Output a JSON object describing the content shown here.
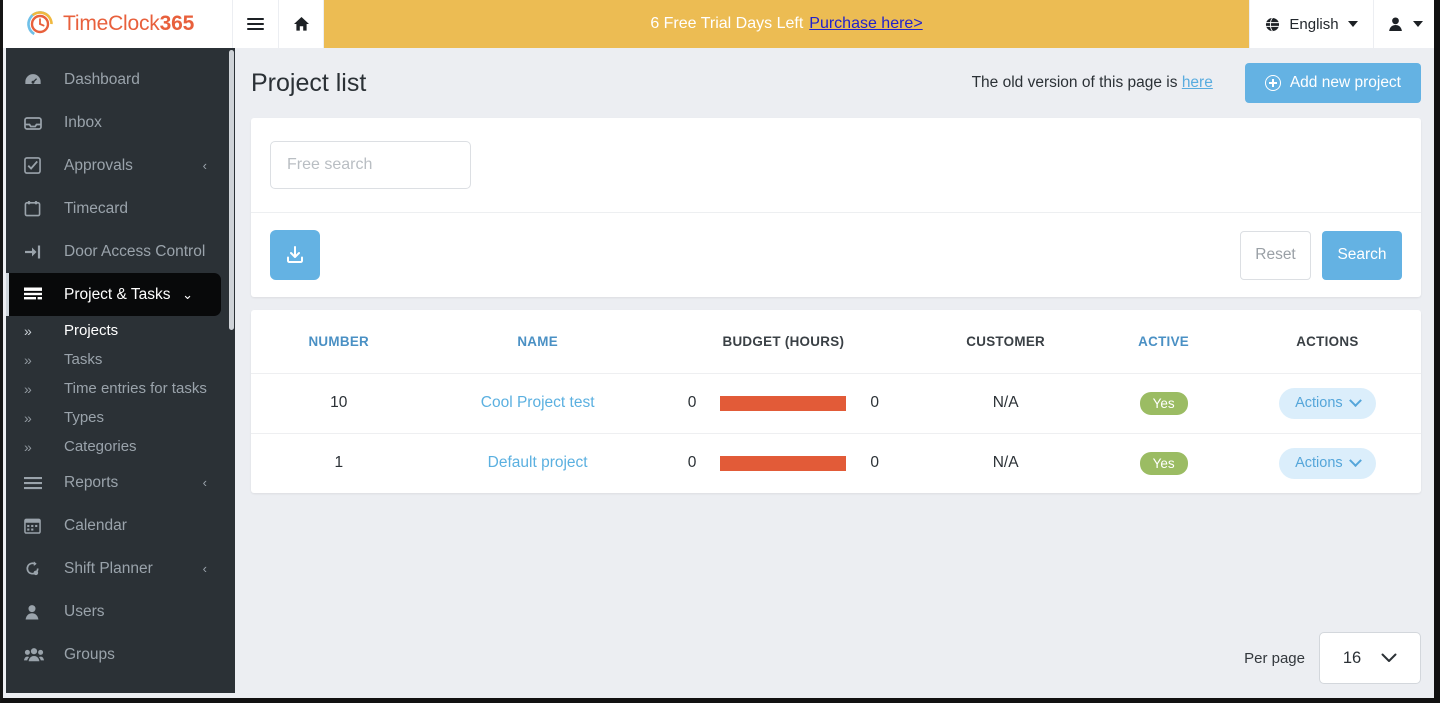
{
  "app": {
    "brand_primary": "TimeClock",
    "brand_secondary": "365",
    "accent_blue": "#64b2e3",
    "accent_orange": "#e25b38",
    "banner_gold": "#ecbc53",
    "sidebar_bg": "#2b3136"
  },
  "topbar": {
    "menu_toggle": "☰",
    "home_icon": "home-icon",
    "trial_text": "6 Free Trial Days Left",
    "trial_link": "Purchase here>",
    "language": "English",
    "globe_icon": "🌐",
    "user_icon": "user-icon"
  },
  "sidebar": {
    "items": [
      {
        "label": "Dashboard",
        "icon": "dashboard-icon",
        "glyph": "◔",
        "expandable": false,
        "active": false
      },
      {
        "label": "Inbox",
        "icon": "inbox-icon",
        "glyph": "✉",
        "expandable": false,
        "active": false
      },
      {
        "label": "Approvals",
        "icon": "check-square-icon",
        "glyph": "☑",
        "expandable": true,
        "arrow": "‹",
        "active": false
      },
      {
        "label": "Timecard",
        "icon": "calendar-icon",
        "glyph": "🗓",
        "expandable": false,
        "active": false
      },
      {
        "label": "Door Access Control",
        "icon": "door-access-icon",
        "glyph": "⇥",
        "expandable": false,
        "active": false
      },
      {
        "label": "Project & Tasks",
        "icon": "project-tasks-icon",
        "glyph": "☰",
        "expandable": true,
        "arrow": "⌄",
        "active": true
      }
    ],
    "subitems": [
      {
        "label": "Projects",
        "icon": "chevron-double-right-icon",
        "glyph": "»",
        "current": true
      },
      {
        "label": "Tasks",
        "icon": "chevron-double-right-icon",
        "glyph": "»",
        "current": false
      },
      {
        "label": "Time entries for tasks",
        "icon": "chevron-double-right-icon",
        "glyph": "»",
        "current": false
      },
      {
        "label": "Types",
        "icon": "chevron-double-right-icon",
        "glyph": "»",
        "current": false
      },
      {
        "label": "Categories",
        "icon": "chevron-double-right-icon",
        "glyph": "»",
        "current": false
      }
    ],
    "items_after": [
      {
        "label": "Reports",
        "icon": "list-icon",
        "glyph": "≡",
        "expandable": true,
        "arrow": "‹",
        "active": false
      },
      {
        "label": "Calendar",
        "icon": "calendar-grid-icon",
        "glyph": "📅",
        "expandable": false,
        "active": false
      },
      {
        "label": "Shift Planner",
        "icon": "shift-planner-icon",
        "glyph": "↻",
        "expandable": true,
        "arrow": "‹",
        "active": false
      },
      {
        "label": "Users",
        "icon": "user-icon",
        "glyph": "👤",
        "expandable": false,
        "active": false
      },
      {
        "label": "Groups",
        "icon": "group-icon",
        "glyph": "👥",
        "expandable": false,
        "active": false
      }
    ]
  },
  "page": {
    "title": "Project list",
    "old_version_text": "The old version of this page is",
    "old_version_link": "here",
    "add_button": "Add new project"
  },
  "search": {
    "placeholder": "Free search",
    "value": "",
    "export_icon": "download-icon",
    "reset_label": "Reset",
    "search_label": "Search"
  },
  "table": {
    "columns": [
      {
        "label": "NUMBER",
        "sortable": true
      },
      {
        "label": "NAME",
        "sortable": true
      },
      {
        "label": "BUDGET (HOURS)",
        "sortable": false
      },
      {
        "label": "CUSTOMER",
        "sortable": false
      },
      {
        "label": "ACTIVE",
        "sortable": true
      },
      {
        "label": "ACTIONS",
        "sortable": false
      }
    ],
    "rows": [
      {
        "number": "10",
        "name": "Cool Project test",
        "budget_left": "0",
        "budget_right": "0",
        "bar_percent": 100,
        "customer": "N/A",
        "active": "Yes",
        "actions_label": "Actions"
      },
      {
        "number": "1",
        "name": "Default project",
        "budget_left": "0",
        "budget_right": "0",
        "bar_percent": 100,
        "customer": "N/A",
        "active": "Yes",
        "actions_label": "Actions"
      }
    ]
  },
  "pagination": {
    "per_page_label": "Per page",
    "per_page_value": "16"
  }
}
